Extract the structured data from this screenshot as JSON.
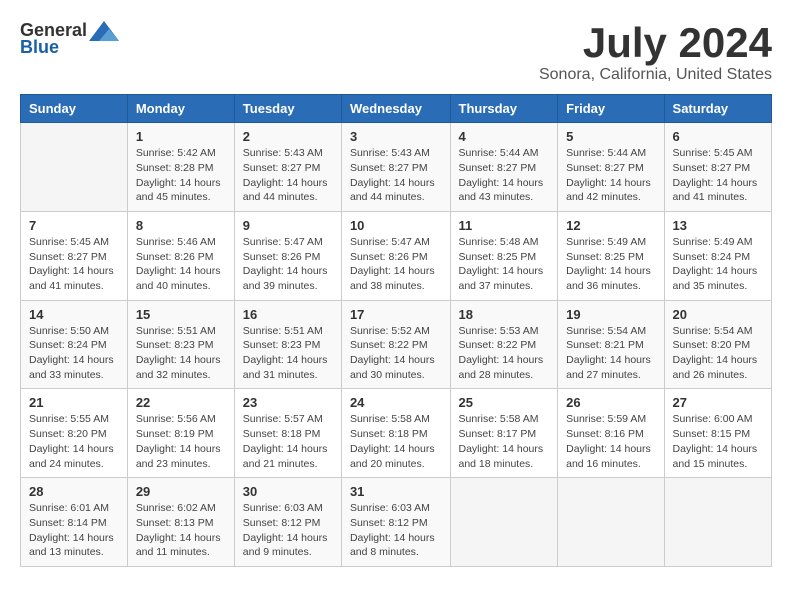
{
  "header": {
    "logo_general": "General",
    "logo_blue": "Blue",
    "month_year": "July 2024",
    "location": "Sonora, California, United States"
  },
  "days_of_week": [
    "Sunday",
    "Monday",
    "Tuesday",
    "Wednesday",
    "Thursday",
    "Friday",
    "Saturday"
  ],
  "weeks": [
    [
      {
        "day": "",
        "info": ""
      },
      {
        "day": "1",
        "info": "Sunrise: 5:42 AM\nSunset: 8:28 PM\nDaylight: 14 hours\nand 45 minutes."
      },
      {
        "day": "2",
        "info": "Sunrise: 5:43 AM\nSunset: 8:27 PM\nDaylight: 14 hours\nand 44 minutes."
      },
      {
        "day": "3",
        "info": "Sunrise: 5:43 AM\nSunset: 8:27 PM\nDaylight: 14 hours\nand 44 minutes."
      },
      {
        "day": "4",
        "info": "Sunrise: 5:44 AM\nSunset: 8:27 PM\nDaylight: 14 hours\nand 43 minutes."
      },
      {
        "day": "5",
        "info": "Sunrise: 5:44 AM\nSunset: 8:27 PM\nDaylight: 14 hours\nand 42 minutes."
      },
      {
        "day": "6",
        "info": "Sunrise: 5:45 AM\nSunset: 8:27 PM\nDaylight: 14 hours\nand 41 minutes."
      }
    ],
    [
      {
        "day": "7",
        "info": "Sunrise: 5:45 AM\nSunset: 8:27 PM\nDaylight: 14 hours\nand 41 minutes."
      },
      {
        "day": "8",
        "info": "Sunrise: 5:46 AM\nSunset: 8:26 PM\nDaylight: 14 hours\nand 40 minutes."
      },
      {
        "day": "9",
        "info": "Sunrise: 5:47 AM\nSunset: 8:26 PM\nDaylight: 14 hours\nand 39 minutes."
      },
      {
        "day": "10",
        "info": "Sunrise: 5:47 AM\nSunset: 8:26 PM\nDaylight: 14 hours\nand 38 minutes."
      },
      {
        "day": "11",
        "info": "Sunrise: 5:48 AM\nSunset: 8:25 PM\nDaylight: 14 hours\nand 37 minutes."
      },
      {
        "day": "12",
        "info": "Sunrise: 5:49 AM\nSunset: 8:25 PM\nDaylight: 14 hours\nand 36 minutes."
      },
      {
        "day": "13",
        "info": "Sunrise: 5:49 AM\nSunset: 8:24 PM\nDaylight: 14 hours\nand 35 minutes."
      }
    ],
    [
      {
        "day": "14",
        "info": "Sunrise: 5:50 AM\nSunset: 8:24 PM\nDaylight: 14 hours\nand 33 minutes."
      },
      {
        "day": "15",
        "info": "Sunrise: 5:51 AM\nSunset: 8:23 PM\nDaylight: 14 hours\nand 32 minutes."
      },
      {
        "day": "16",
        "info": "Sunrise: 5:51 AM\nSunset: 8:23 PM\nDaylight: 14 hours\nand 31 minutes."
      },
      {
        "day": "17",
        "info": "Sunrise: 5:52 AM\nSunset: 8:22 PM\nDaylight: 14 hours\nand 30 minutes."
      },
      {
        "day": "18",
        "info": "Sunrise: 5:53 AM\nSunset: 8:22 PM\nDaylight: 14 hours\nand 28 minutes."
      },
      {
        "day": "19",
        "info": "Sunrise: 5:54 AM\nSunset: 8:21 PM\nDaylight: 14 hours\nand 27 minutes."
      },
      {
        "day": "20",
        "info": "Sunrise: 5:54 AM\nSunset: 8:20 PM\nDaylight: 14 hours\nand 26 minutes."
      }
    ],
    [
      {
        "day": "21",
        "info": "Sunrise: 5:55 AM\nSunset: 8:20 PM\nDaylight: 14 hours\nand 24 minutes."
      },
      {
        "day": "22",
        "info": "Sunrise: 5:56 AM\nSunset: 8:19 PM\nDaylight: 14 hours\nand 23 minutes."
      },
      {
        "day": "23",
        "info": "Sunrise: 5:57 AM\nSunset: 8:18 PM\nDaylight: 14 hours\nand 21 minutes."
      },
      {
        "day": "24",
        "info": "Sunrise: 5:58 AM\nSunset: 8:18 PM\nDaylight: 14 hours\nand 20 minutes."
      },
      {
        "day": "25",
        "info": "Sunrise: 5:58 AM\nSunset: 8:17 PM\nDaylight: 14 hours\nand 18 minutes."
      },
      {
        "day": "26",
        "info": "Sunrise: 5:59 AM\nSunset: 8:16 PM\nDaylight: 14 hours\nand 16 minutes."
      },
      {
        "day": "27",
        "info": "Sunrise: 6:00 AM\nSunset: 8:15 PM\nDaylight: 14 hours\nand 15 minutes."
      }
    ],
    [
      {
        "day": "28",
        "info": "Sunrise: 6:01 AM\nSunset: 8:14 PM\nDaylight: 14 hours\nand 13 minutes."
      },
      {
        "day": "29",
        "info": "Sunrise: 6:02 AM\nSunset: 8:13 PM\nDaylight: 14 hours\nand 11 minutes."
      },
      {
        "day": "30",
        "info": "Sunrise: 6:03 AM\nSunset: 8:12 PM\nDaylight: 14 hours\nand 9 minutes."
      },
      {
        "day": "31",
        "info": "Sunrise: 6:03 AM\nSunset: 8:12 PM\nDaylight: 14 hours\nand 8 minutes."
      },
      {
        "day": "",
        "info": ""
      },
      {
        "day": "",
        "info": ""
      },
      {
        "day": "",
        "info": ""
      }
    ]
  ]
}
